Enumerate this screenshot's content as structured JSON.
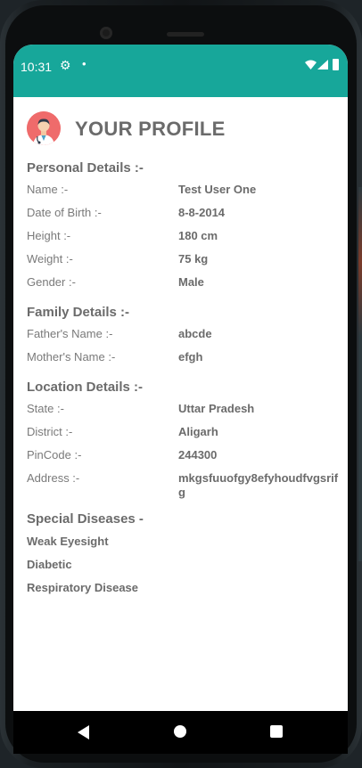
{
  "status_bar": {
    "time": "10:31",
    "icons": [
      "gear-icon",
      "dot-icon",
      "wifi-icon",
      "signal-icon",
      "battery-icon"
    ],
    "background_color": "#17a79a"
  },
  "profile": {
    "title": "YOUR PROFILE",
    "avatar_icon": "doctor-avatar-icon"
  },
  "personal": {
    "heading": "Personal Details :-",
    "rows": [
      {
        "label": "Name :-",
        "value": "Test User One"
      },
      {
        "label": "Date of Birth :-",
        "value": "8-8-2014"
      },
      {
        "label": "Height :-",
        "value": "180 cm"
      },
      {
        "label": "Weight :-",
        "value": "75 kg"
      },
      {
        "label": "Gender :-",
        "value": "Male"
      }
    ]
  },
  "family": {
    "heading": "Family Details :-",
    "rows": [
      {
        "label": "Father's Name :-",
        "value": "abcde"
      },
      {
        "label": "Mother's Name :-",
        "value": "efgh"
      }
    ]
  },
  "location": {
    "heading": "Location Details :-",
    "rows": [
      {
        "label": "State :-",
        "value": "Uttar Pradesh"
      },
      {
        "label": "District :-",
        "value": "Aligarh"
      },
      {
        "label": "PinCode :-",
        "value": "244300"
      },
      {
        "label": "Address :-",
        "value": "mkgsfuuofgy8efyhoudfvgsrifg"
      }
    ]
  },
  "diseases": {
    "heading": "Special Diseases -",
    "items": [
      "Weak Eyesight",
      "Diabetic",
      "Respiratory Disease"
    ]
  },
  "nav": {
    "icons": [
      "back-icon",
      "home-icon",
      "recents-icon"
    ]
  }
}
